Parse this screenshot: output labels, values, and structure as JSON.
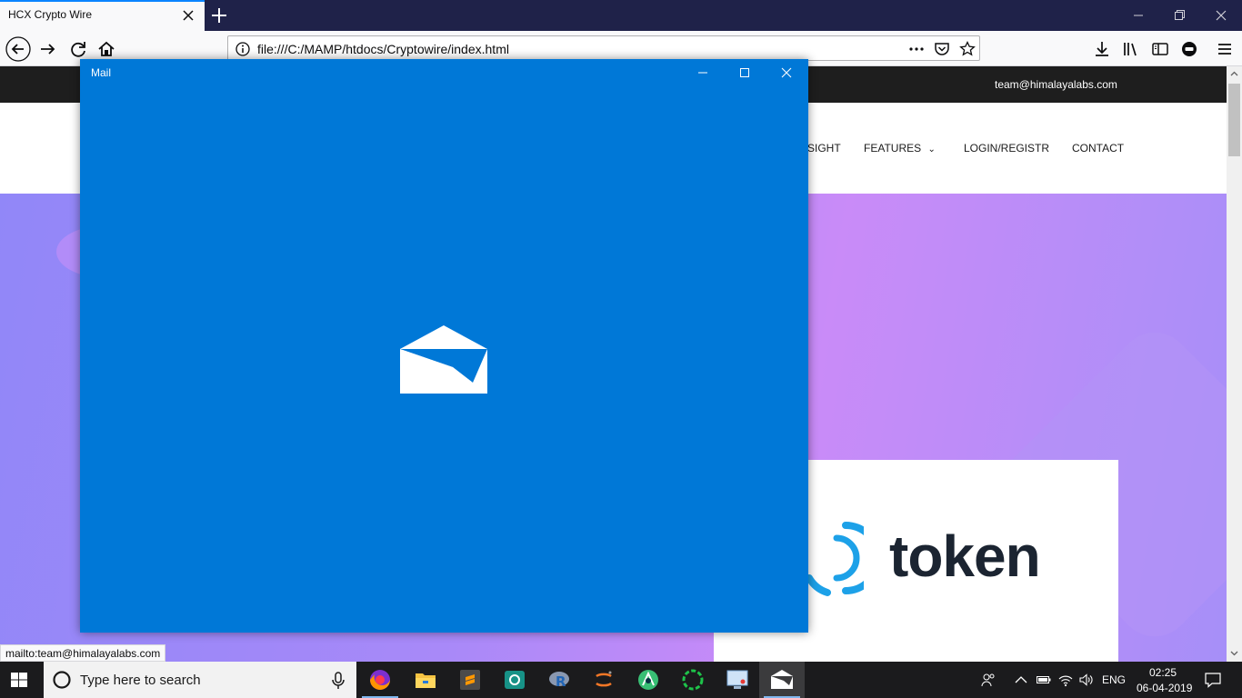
{
  "browser": {
    "tab_title": "HCX Crypto Wire",
    "url": "file:///C:/MAMP/htdocs/Cryptowire/index.html",
    "status_tip": "mailto:team@himalayalabs.com"
  },
  "website": {
    "email": "team@himalayalabs.com",
    "nav": [
      "SIGHT",
      "FEATURES",
      "LOGIN/REGISTR",
      "CONTACT"
    ],
    "token_word": "token"
  },
  "mail_window": {
    "title": "Mail",
    "background_color": "#0078d7"
  },
  "taskbar": {
    "search_placeholder": "Type here to search",
    "apps": [
      "firefox-icon",
      "file-explorer-icon",
      "sublime-text-icon",
      "gitkraken-icon",
      "r-icon",
      "jupyter-icon",
      "android-studio-icon",
      "spinner-app-icon",
      "remote-desktop-icon",
      "mail-icon"
    ],
    "language": "ENG",
    "time": "02:25",
    "date": "06-04-2019"
  }
}
